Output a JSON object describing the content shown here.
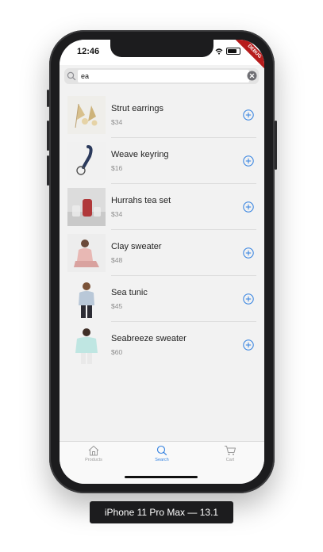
{
  "status_bar": {
    "time": "12:46",
    "debug_banner": "DEBUG"
  },
  "search": {
    "value": "ea"
  },
  "products": [
    {
      "name": "Strut earrings",
      "price": "$34",
      "thumb": "earrings"
    },
    {
      "name": "Weave keyring",
      "price": "$16",
      "thumb": "keyring"
    },
    {
      "name": "Hurrahs tea set",
      "price": "$34",
      "thumb": "tea-set"
    },
    {
      "name": "Clay sweater",
      "price": "$48",
      "thumb": "sweater-model"
    },
    {
      "name": "Sea tunic",
      "price": "$45",
      "thumb": "tunic-model"
    },
    {
      "name": "Seabreeze sweater",
      "price": "$60",
      "thumb": "seabreeze-model"
    }
  ],
  "tabs": [
    {
      "label": "Products",
      "icon": "home-icon",
      "active": false
    },
    {
      "label": "Search",
      "icon": "search-icon",
      "active": true
    },
    {
      "label": "Cart",
      "icon": "cart-icon",
      "active": false
    }
  ],
  "device_label": "iPhone 11 Pro Max — 13.1",
  "colors": {
    "accent": "#2f7fe0",
    "inactive": "#9a9a9a",
    "debug": "#b71c1c"
  }
}
